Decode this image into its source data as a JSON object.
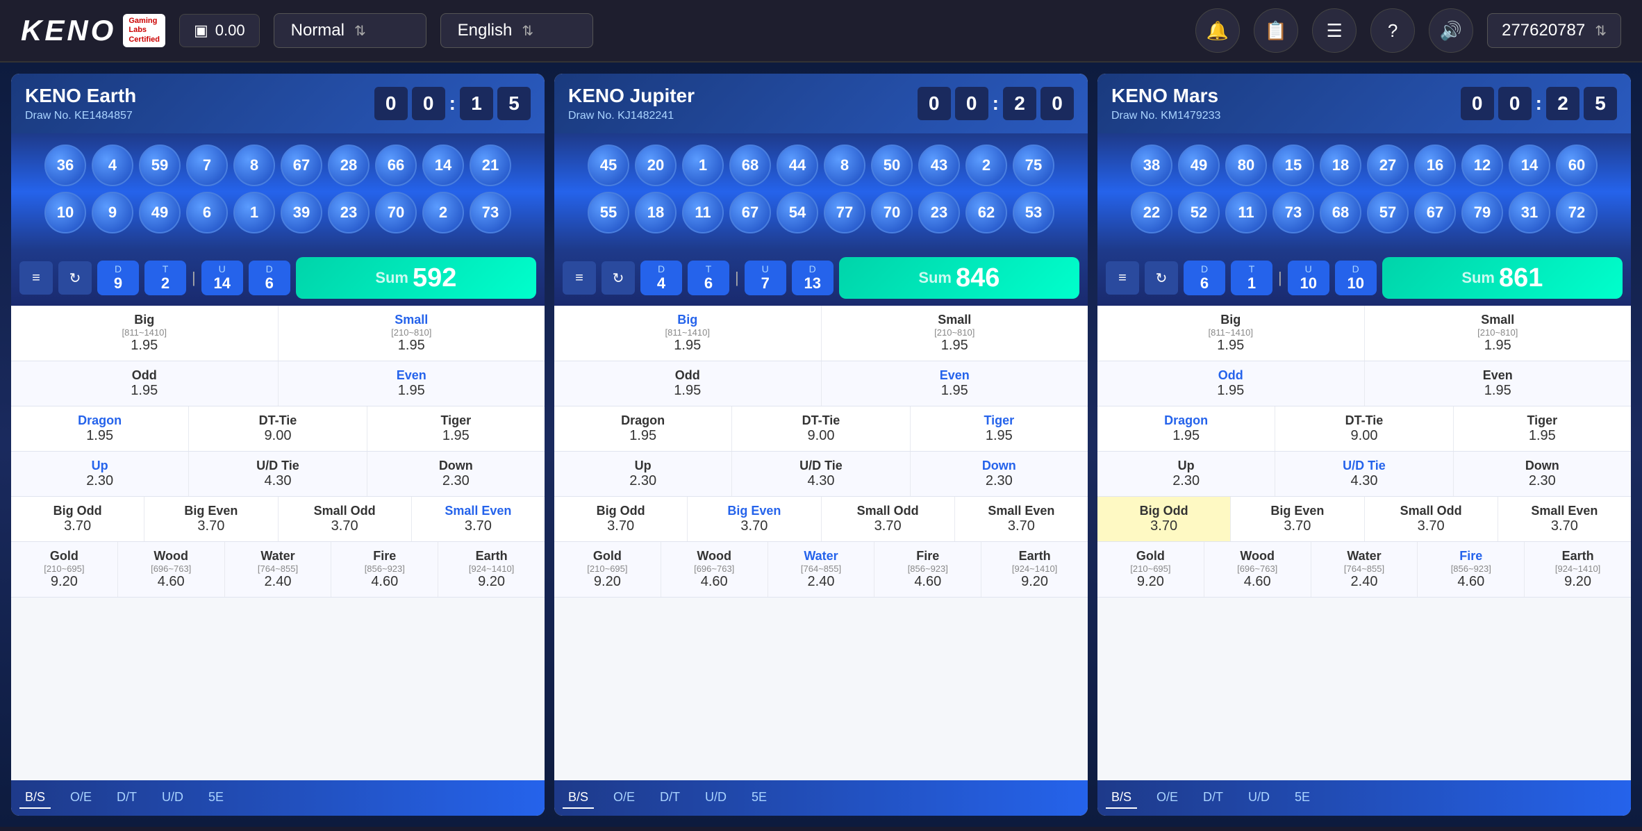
{
  "header": {
    "logo_text": "KENO",
    "logo_badge_line1": "Gaming",
    "logo_badge_line2": "Labs",
    "logo_badge_line3": "Certified",
    "balance": "0.00",
    "mode_label": "Normal",
    "language_label": "English",
    "account_id": "277620787",
    "icons": {
      "wallet": "▣",
      "bell": "🔔",
      "edit": "📝",
      "list": "☰",
      "question": "?",
      "sound": "🔊"
    }
  },
  "panels": [
    {
      "id": "earth",
      "title": "KENO Earth",
      "draw_no": "Draw No. KE1484857",
      "timer": [
        "0",
        "0",
        "1",
        "5"
      ],
      "balls_row1": [
        36,
        4,
        59,
        7,
        8,
        67,
        28,
        66,
        14,
        21
      ],
      "balls_row2": [
        10,
        9,
        49,
        6,
        1,
        39,
        23,
        70,
        2,
        73
      ],
      "stats": {
        "D_label": "D",
        "D_val": 9,
        "T_label": "T",
        "T_val": 2,
        "U_label": "U",
        "U_val": 14,
        "D2_label": "D",
        "D2_val": 6
      },
      "sum": 592,
      "bets": [
        {
          "cols": [
            {
              "name": "Big",
              "range": "[811~1410]",
              "odds": "1.95",
              "highlight_name": false,
              "highlight_odds": false
            },
            {
              "name": "Small",
              "range": "[210~810]",
              "odds": "1.95",
              "highlight_name": true,
              "highlight_odds": false
            }
          ]
        },
        {
          "cols": [
            {
              "name": "Odd",
              "range": "",
              "odds": "1.95",
              "highlight_name": false,
              "highlight_odds": false
            },
            {
              "name": "Even",
              "range": "",
              "odds": "1.95",
              "highlight_name": true,
              "highlight_odds": false
            }
          ]
        },
        {
          "cols": [
            {
              "name": "Dragon",
              "range": "",
              "odds": "1.95",
              "highlight_name": true,
              "highlight_odds": false
            },
            {
              "name": "DT-Tie",
              "range": "",
              "odds": "9.00",
              "highlight_name": false,
              "highlight_odds": false
            },
            {
              "name": "Tiger",
              "range": "",
              "odds": "1.95",
              "highlight_name": false,
              "highlight_odds": false
            }
          ]
        },
        {
          "cols": [
            {
              "name": "Up",
              "range": "",
              "odds": "2.30",
              "highlight_name": true,
              "highlight_odds": false
            },
            {
              "name": "U/D Tie",
              "range": "",
              "odds": "4.30",
              "highlight_name": false,
              "highlight_odds": false
            },
            {
              "name": "Down",
              "range": "",
              "odds": "2.30",
              "highlight_name": false,
              "highlight_odds": false
            }
          ]
        },
        {
          "cols": [
            {
              "name": "Big Odd",
              "range": "",
              "odds": "3.70",
              "highlight_name": false,
              "highlight_odds": false
            },
            {
              "name": "Big Even",
              "range": "",
              "odds": "3.70",
              "highlight_name": false,
              "highlight_odds": false
            },
            {
              "name": "Small Odd",
              "range": "",
              "odds": "3.70",
              "highlight_name": false,
              "highlight_odds": false
            },
            {
              "name": "Small Even",
              "range": "",
              "odds": "3.70",
              "highlight_name": true,
              "highlight_odds": false
            }
          ]
        },
        {
          "cols": [
            {
              "name": "Gold",
              "range": "[210~695]",
              "odds": "9.20",
              "highlight_name": false,
              "highlight_odds": false
            },
            {
              "name": "Wood",
              "range": "[696~763]",
              "odds": "4.60",
              "highlight_name": false,
              "highlight_odds": false
            },
            {
              "name": "Water",
              "range": "[764~855]",
              "odds": "2.40",
              "highlight_name": false,
              "highlight_odds": false
            },
            {
              "name": "Fire",
              "range": "[856~923]",
              "odds": "4.60",
              "highlight_name": false,
              "highlight_odds": false
            },
            {
              "name": "Earth",
              "range": "[924~1410]",
              "odds": "9.20",
              "highlight_name": false,
              "highlight_odds": false
            }
          ]
        }
      ],
      "bottom_tabs": [
        "B/S",
        "O/E",
        "D/T",
        "U/D",
        "5E"
      ]
    },
    {
      "id": "jupiter",
      "title": "KENO Jupiter",
      "draw_no": "Draw No. KJ1482241",
      "timer": [
        "0",
        "0",
        "2",
        "0"
      ],
      "balls_row1": [
        45,
        20,
        1,
        68,
        44,
        8,
        50,
        43,
        2,
        75
      ],
      "balls_row2": [
        55,
        18,
        11,
        67,
        54,
        77,
        70,
        23,
        62,
        53
      ],
      "stats": {
        "D_label": "D",
        "D_val": 4,
        "T_label": "T",
        "T_val": 6,
        "U_label": "U",
        "U_val": 7,
        "D2_label": "D",
        "D2_val": 13
      },
      "sum": 846,
      "bets": [
        {
          "cols": [
            {
              "name": "Big",
              "range": "[811~1410]",
              "odds": "1.95",
              "highlight_name": true,
              "highlight_odds": false
            },
            {
              "name": "Small",
              "range": "[210~810]",
              "odds": "1.95",
              "highlight_name": false,
              "highlight_odds": false
            }
          ]
        },
        {
          "cols": [
            {
              "name": "Odd",
              "range": "",
              "odds": "1.95",
              "highlight_name": false,
              "highlight_odds": false
            },
            {
              "name": "Even",
              "range": "",
              "odds": "1.95",
              "highlight_name": true,
              "highlight_odds": false
            }
          ]
        },
        {
          "cols": [
            {
              "name": "Dragon",
              "range": "",
              "odds": "1.95",
              "highlight_name": false,
              "highlight_odds": false
            },
            {
              "name": "DT-Tie",
              "range": "",
              "odds": "9.00",
              "highlight_name": false,
              "highlight_odds": false
            },
            {
              "name": "Tiger",
              "range": "",
              "odds": "1.95",
              "highlight_name": true,
              "highlight_odds": false
            }
          ]
        },
        {
          "cols": [
            {
              "name": "Up",
              "range": "",
              "odds": "2.30",
              "highlight_name": false,
              "highlight_odds": false
            },
            {
              "name": "U/D Tie",
              "range": "",
              "odds": "4.30",
              "highlight_name": false,
              "highlight_odds": false
            },
            {
              "name": "Down",
              "range": "",
              "odds": "2.30",
              "highlight_name": true,
              "highlight_odds": false
            }
          ]
        },
        {
          "cols": [
            {
              "name": "Big Odd",
              "range": "",
              "odds": "3.70",
              "highlight_name": false,
              "highlight_odds": false
            },
            {
              "name": "Big Even",
              "range": "",
              "odds": "3.70",
              "highlight_name": true,
              "highlight_odds": false
            },
            {
              "name": "Small Odd",
              "range": "",
              "odds": "3.70",
              "highlight_name": false,
              "highlight_odds": false
            },
            {
              "name": "Small Even",
              "range": "",
              "odds": "3.70",
              "highlight_name": false,
              "highlight_odds": false
            }
          ]
        },
        {
          "cols": [
            {
              "name": "Gold",
              "range": "[210~695]",
              "odds": "9.20",
              "highlight_name": false,
              "highlight_odds": false
            },
            {
              "name": "Wood",
              "range": "[696~763]",
              "odds": "4.60",
              "highlight_name": false,
              "highlight_odds": false
            },
            {
              "name": "Water",
              "range": "[764~855]",
              "odds": "2.40",
              "highlight_name": true,
              "highlight_odds": false
            },
            {
              "name": "Fire",
              "range": "[856~923]",
              "odds": "4.60",
              "highlight_name": false,
              "highlight_odds": false
            },
            {
              "name": "Earth",
              "range": "[924~1410]",
              "odds": "9.20",
              "highlight_name": false,
              "highlight_odds": false
            }
          ]
        }
      ],
      "bottom_tabs": [
        "B/S",
        "O/E",
        "D/T",
        "U/D",
        "5E"
      ]
    },
    {
      "id": "mars",
      "title": "KENO Mars",
      "draw_no": "Draw No. KM1479233",
      "timer": [
        "0",
        "0",
        "2",
        "5"
      ],
      "balls_row1": [
        38,
        49,
        80,
        15,
        18,
        27,
        16,
        12,
        14,
        60
      ],
      "balls_row2": [
        22,
        52,
        11,
        73,
        68,
        57,
        67,
        79,
        31,
        72
      ],
      "stats": {
        "D_label": "D",
        "D_val": 6,
        "T_label": "T",
        "T_val": 1,
        "U_label": "U",
        "U_val": 10,
        "D2_label": "D",
        "D2_val": 10
      },
      "sum": 861,
      "bets": [
        {
          "cols": [
            {
              "name": "Big",
              "range": "[811~1410]",
              "odds": "1.95",
              "highlight_name": false,
              "highlight_odds": false
            },
            {
              "name": "Small",
              "range": "[210~810]",
              "odds": "1.95",
              "highlight_name": false,
              "highlight_odds": false
            }
          ]
        },
        {
          "cols": [
            {
              "name": "Odd",
              "range": "",
              "odds": "1.95",
              "highlight_name": true,
              "highlight_odds": false
            },
            {
              "name": "Even",
              "range": "",
              "odds": "1.95",
              "highlight_name": false,
              "highlight_odds": false
            }
          ]
        },
        {
          "cols": [
            {
              "name": "Dragon",
              "range": "",
              "odds": "1.95",
              "highlight_name": true,
              "highlight_odds": false
            },
            {
              "name": "DT-Tie",
              "range": "",
              "odds": "9.00",
              "highlight_name": false,
              "highlight_odds": false
            },
            {
              "name": "Tiger",
              "range": "",
              "odds": "1.95",
              "highlight_name": false,
              "highlight_odds": false
            }
          ]
        },
        {
          "cols": [
            {
              "name": "Up",
              "range": "",
              "odds": "2.30",
              "highlight_name": false,
              "highlight_odds": false
            },
            {
              "name": "U/D Tie",
              "range": "",
              "odds": "4.30",
              "highlight_name": true,
              "highlight_odds": false
            },
            {
              "name": "Down",
              "range": "",
              "odds": "2.30",
              "highlight_name": false,
              "highlight_odds": false
            }
          ]
        },
        {
          "cols": [
            {
              "name": "Big Odd",
              "range": "",
              "odds": "3.70",
              "highlight_name": false,
              "highlight_odds": false,
              "cell_highlight": true
            },
            {
              "name": "Big Even",
              "range": "",
              "odds": "3.70",
              "highlight_name": false,
              "highlight_odds": false
            },
            {
              "name": "Small Odd",
              "range": "",
              "odds": "3.70",
              "highlight_name": false,
              "highlight_odds": false
            },
            {
              "name": "Small Even",
              "range": "",
              "odds": "3.70",
              "highlight_name": false,
              "highlight_odds": false
            }
          ]
        },
        {
          "cols": [
            {
              "name": "Gold",
              "range": "[210~695]",
              "odds": "9.20",
              "highlight_name": false,
              "highlight_odds": false
            },
            {
              "name": "Wood",
              "range": "[696~763]",
              "odds": "4.60",
              "highlight_name": false,
              "highlight_odds": false
            },
            {
              "name": "Water",
              "range": "[764~855]",
              "odds": "2.40",
              "highlight_name": false,
              "highlight_odds": false
            },
            {
              "name": "Fire",
              "range": "[856~923]",
              "odds": "4.60",
              "highlight_name": true,
              "highlight_odds": false
            },
            {
              "name": "Earth",
              "range": "[924~1410]",
              "odds": "9.20",
              "highlight_name": false,
              "highlight_odds": false
            }
          ]
        }
      ],
      "bottom_tabs": [
        "B/S",
        "O/E",
        "D/T",
        "U/D",
        "5E"
      ]
    }
  ]
}
